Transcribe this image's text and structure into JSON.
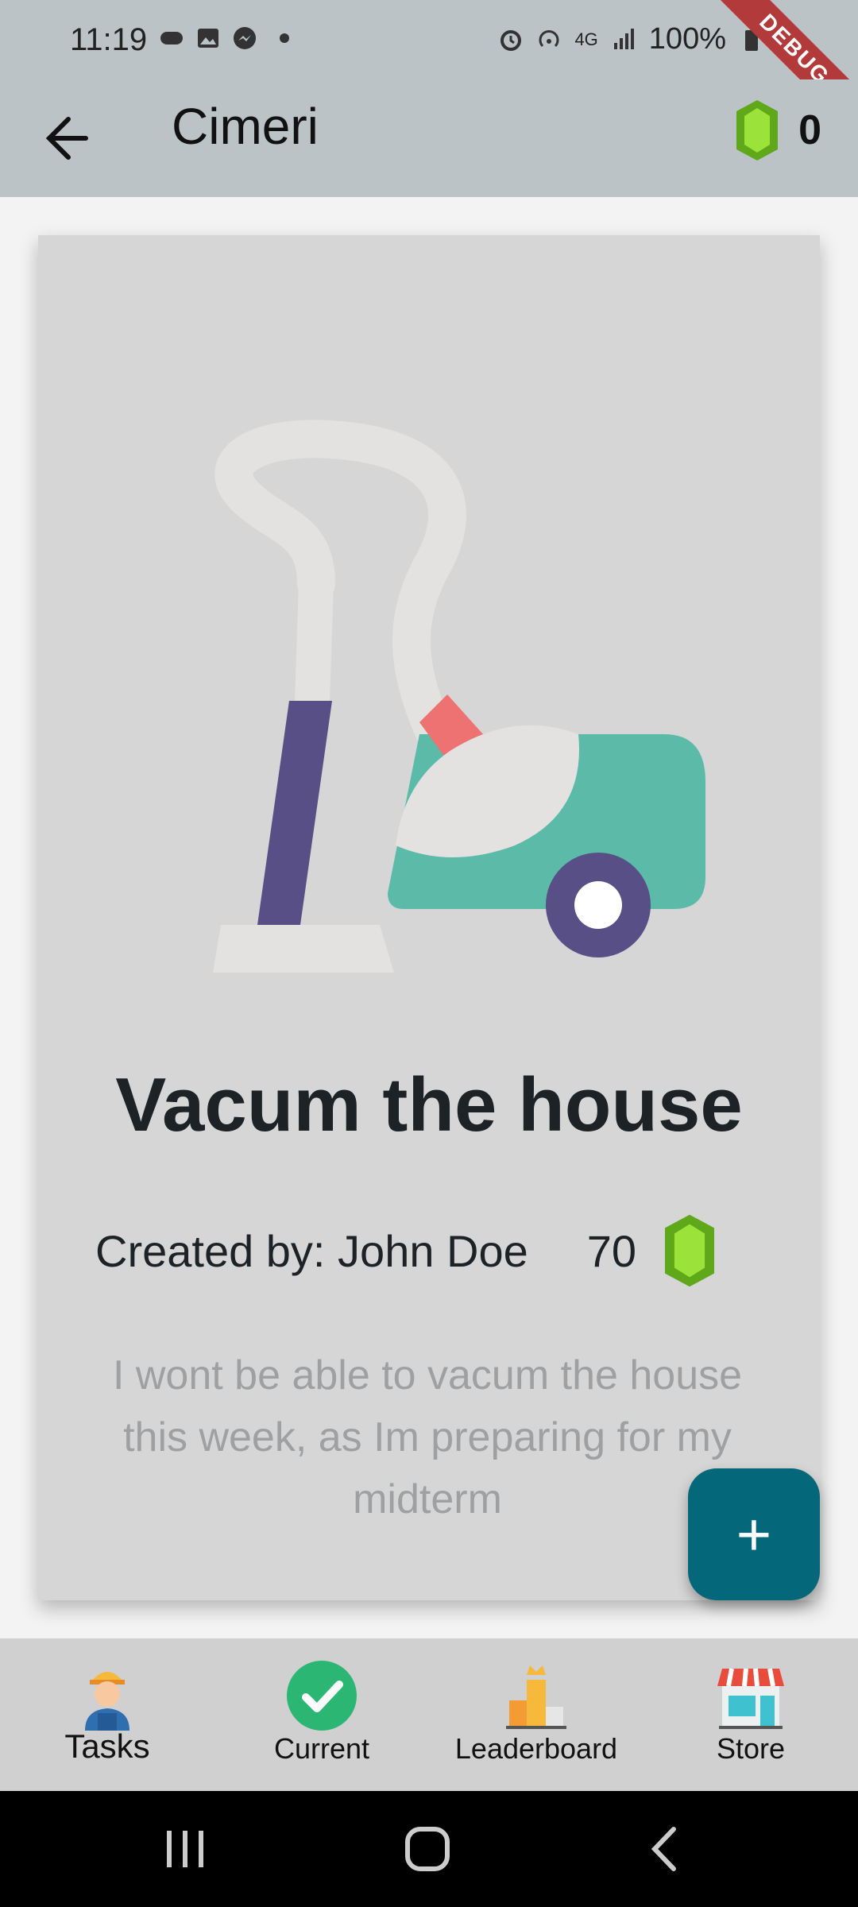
{
  "status": {
    "time": "11:19",
    "battery": "100%",
    "network": "4G",
    "icons_left": [
      "game-controller-icon",
      "image-icon",
      "messenger-icon"
    ],
    "icons_right": [
      "alarm-icon",
      "hotspot-icon",
      "signal-icon",
      "battery-icon"
    ]
  },
  "debug_banner": "DEBUG",
  "app_bar": {
    "title": "Cimeri",
    "gem_balance": "0"
  },
  "task": {
    "title": "Vacum the house",
    "creator": "Created by: John Doe",
    "points": "70",
    "description": "I wont be able to vacum the house this week, as Im preparing for my midterm"
  },
  "fab": {
    "icon": "plus-icon",
    "symbol": "+"
  },
  "bottom_nav": {
    "items": [
      {
        "label": "Tasks",
        "icon": "worker-icon"
      },
      {
        "label": "Current",
        "icon": "check-icon"
      },
      {
        "label": "Leaderboard",
        "icon": "podium-icon"
      },
      {
        "label": "Store",
        "icon": "store-icon"
      }
    ]
  },
  "colors": {
    "app_bar": "#bcc3c7",
    "card": "#d6d6d6",
    "fab": "#05687a",
    "gem_green": "#7ed321"
  }
}
